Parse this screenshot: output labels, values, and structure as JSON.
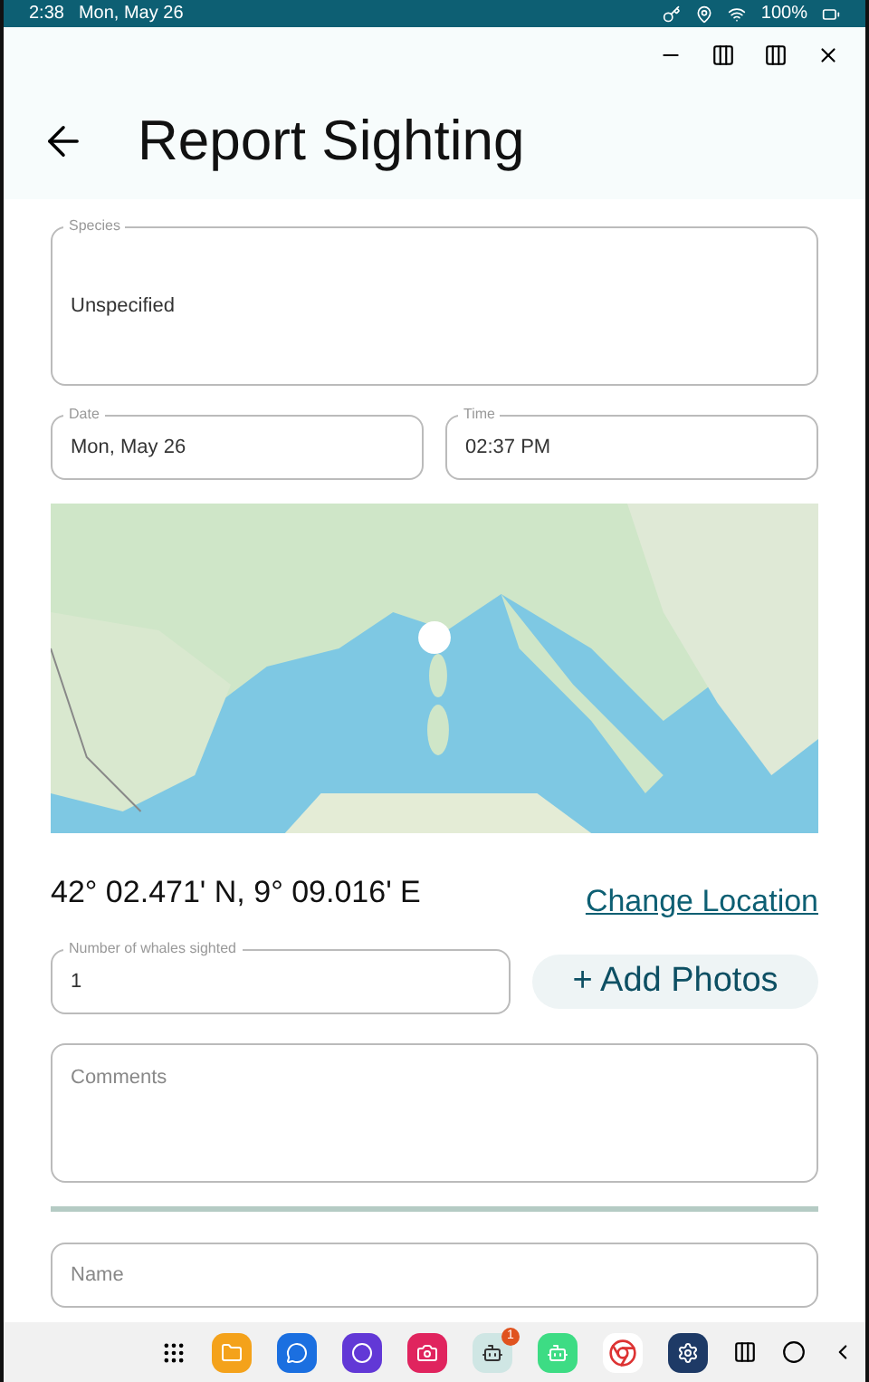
{
  "status_bar": {
    "time": "2:38",
    "date": "Mon, May 26",
    "battery": "100%"
  },
  "header": {
    "title": "Report Sighting"
  },
  "species": {
    "label": "Species",
    "value": "Unspecified"
  },
  "date": {
    "label": "Date",
    "value": "Mon, May 26"
  },
  "time": {
    "label": "Time",
    "value": "02:37 PM"
  },
  "location": {
    "coordinates": "42° 02.471' N, 9° 09.016' E",
    "change_link": "Change Location"
  },
  "count": {
    "label": "Number of whales sighted",
    "value": "1"
  },
  "add_photos": "+ Add Photos",
  "comments": {
    "placeholder": "Comments"
  },
  "name": {
    "placeholder": "Name"
  },
  "taskbar": {
    "badge": "1"
  }
}
